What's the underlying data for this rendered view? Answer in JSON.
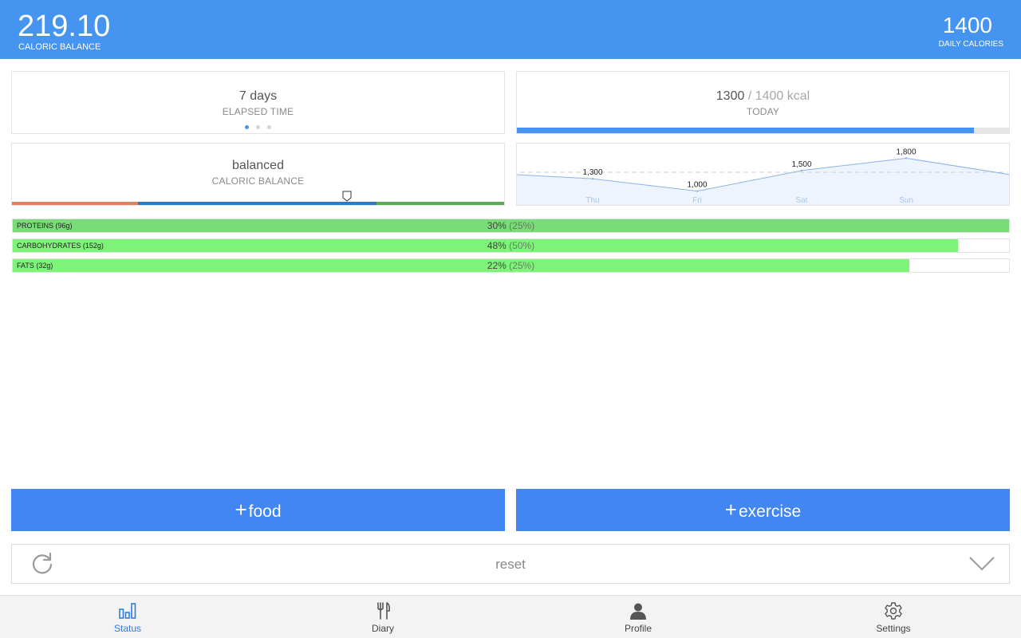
{
  "header": {
    "balance_value": "219.10",
    "balance_label": "CALORIC BALANCE",
    "daily_value": "1400",
    "daily_label": "DAILY CALORIES"
  },
  "elapsed": {
    "value": "7 days",
    "label": "ELAPSED TIME",
    "pager_pages": 3,
    "pager_active": 1
  },
  "today": {
    "consumed": "1300",
    "separator_goal": " / 1400 kcal",
    "label": "TODAY",
    "progress_fraction": 0.929
  },
  "balance": {
    "value": "balanced",
    "label": "CALORIC BALANCE",
    "marker_fraction": 0.678,
    "segment_colors": [
      "#e0825e",
      "#2f7bc1",
      "#5aad52"
    ]
  },
  "chart_data": {
    "type": "area",
    "categories": [
      "Thu",
      "Fri",
      "Sat",
      "Sun"
    ],
    "values": [
      1300,
      1000,
      1500,
      1800
    ],
    "data_labels": [
      "1,300",
      "1,000",
      "1,500",
      "1,800"
    ],
    "reference_line": "dashed",
    "colors": {
      "line": "#8ab4e6",
      "fill": "#eef4fd",
      "axis_labels": "#a9c7ea"
    }
  },
  "macros": [
    {
      "label": "PROTEINS (96g)",
      "pct": "30%",
      "target": "(25%)",
      "fill_fraction": 1.0,
      "color": "#7adc78"
    },
    {
      "label": "CARBOHYDRATES (152g)",
      "pct": "48%",
      "target": "(50%)",
      "fill_fraction": 0.949,
      "color": "#7df378"
    },
    {
      "label": "FATS (32g)",
      "pct": "22%",
      "target": "(25%)",
      "fill_fraction": 0.9,
      "color": "#7df378"
    }
  ],
  "actions": {
    "food_label": "food",
    "exercise_label": "exercise",
    "plus_glyph": "+",
    "color": "#4286f1"
  },
  "reset": {
    "label": "reset",
    "left_icon": "refresh-icon",
    "right_icon": "chevron-down-icon"
  },
  "tabs": [
    {
      "label": "Status",
      "icon": "bar-chart-icon",
      "active": true
    },
    {
      "label": "Diary",
      "icon": "fork-knife-icon",
      "active": false
    },
    {
      "label": "Profile",
      "icon": "user-icon",
      "active": false
    },
    {
      "label": "Settings",
      "icon": "gear-icon",
      "active": false
    }
  ],
  "colors": {
    "header": "#4594ef",
    "accent": "#2d7de0"
  }
}
